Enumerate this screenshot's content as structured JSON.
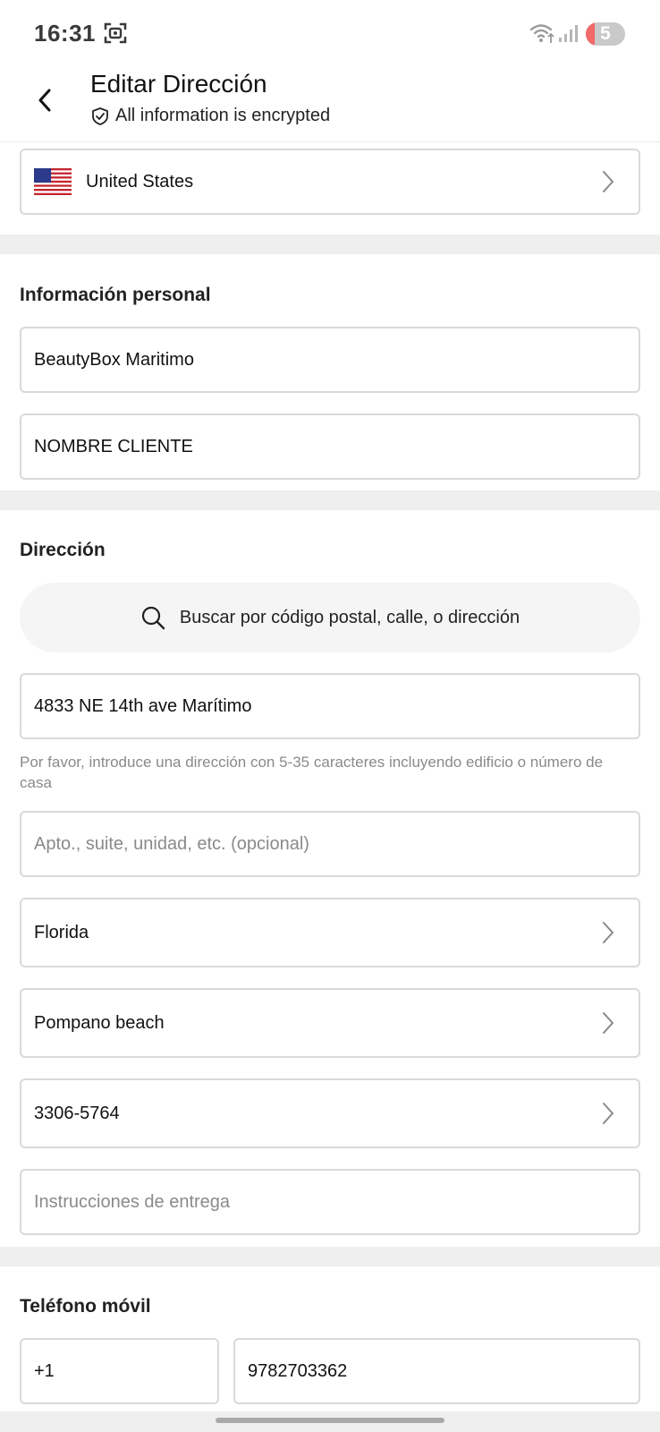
{
  "status_bar": {
    "time": "16:31",
    "battery": "5",
    "icons": [
      "screen-record-icon",
      "wifi-icon",
      "signal-icon",
      "battery-icon"
    ]
  },
  "header": {
    "title": "Editar Dirección",
    "encrypted_note": "All information is encrypted"
  },
  "country": {
    "name": "United States",
    "flag_icon": "us-flag-icon"
  },
  "personal": {
    "section_title": "Información personal",
    "first_name": "BeautyBox Maritimo",
    "last_name": "NOMBRE CLIENTE"
  },
  "address": {
    "section_title": "Dirección",
    "search_placeholder": "Buscar por código postal, calle, o dirección",
    "street": "4833 NE 14th ave Marítimo",
    "street_hint": "Por favor, introduce una dirección con 5-35 caracteres incluyendo edificio o número de casa",
    "apt_placeholder": "Apto., suite, unidad, etc. (opcional)",
    "state": "Florida",
    "city": "Pompano beach",
    "zip": "3306-5764",
    "instructions_placeholder": "Instrucciones de entrega"
  },
  "phone": {
    "section_title": "Teléfono móvil",
    "country_code": "+1",
    "number": "9782703362"
  },
  "colors": {
    "border": "#d9d9d9",
    "band": "#efefef",
    "hint": "#8a8a8a",
    "battery_low": "#f26a6a"
  }
}
